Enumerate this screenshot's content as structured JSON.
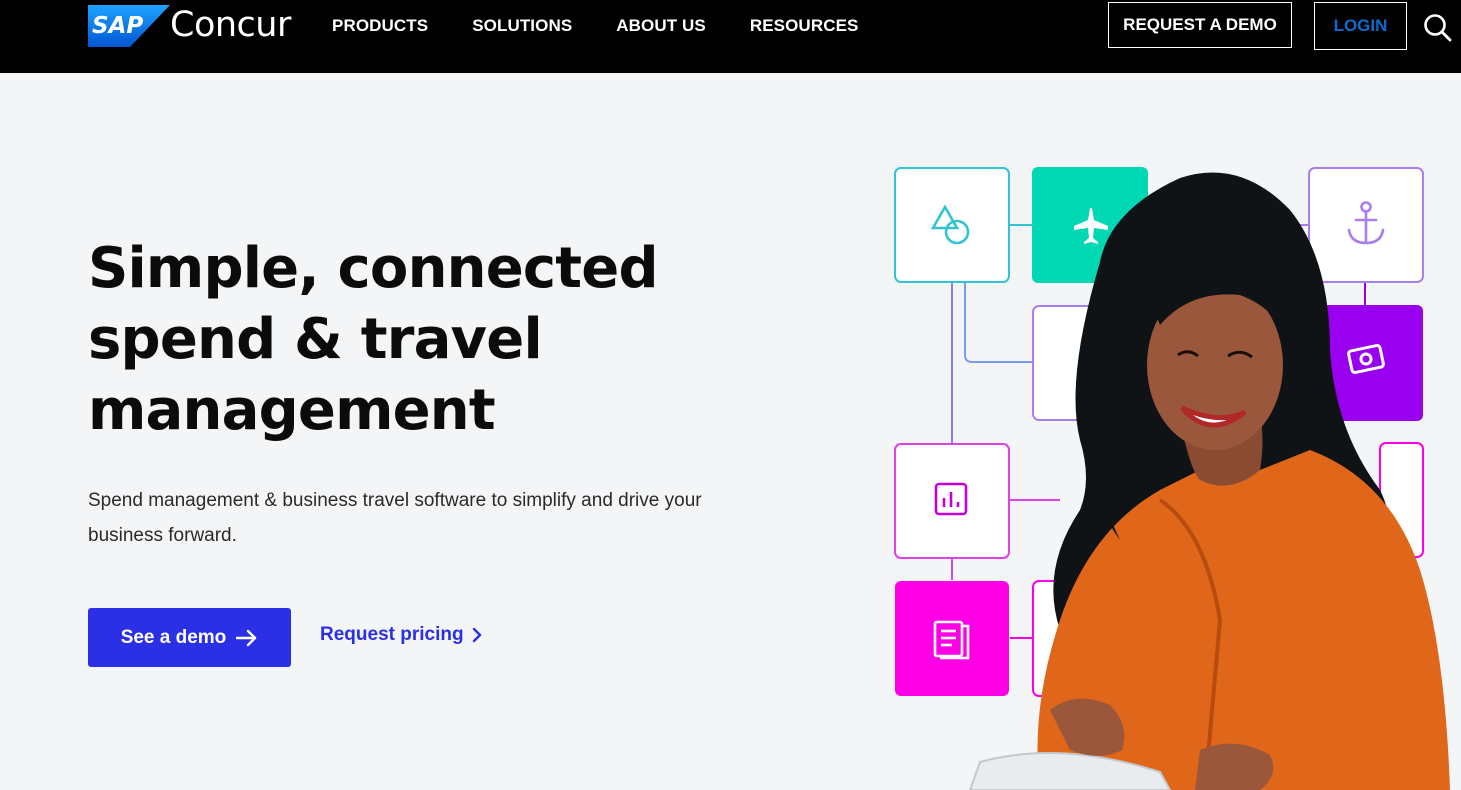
{
  "header": {
    "logo_text": "SAP",
    "brand": "Concur",
    "nav": [
      "PRODUCTS",
      "SOLUTIONS",
      "ABOUT US",
      "RESOURCES"
    ],
    "request_demo_label": "REQUEST A DEMO",
    "login_label": "LOGIN",
    "search_icon": "search-icon"
  },
  "hero": {
    "title": "Simple, connected spend & travel management",
    "subtitle": "Spend management & business travel software to simplify and drive your business forward.",
    "primary_cta": "See a demo",
    "secondary_cta": "Request pricing"
  },
  "illustration": {
    "tiles": [
      "shapes-icon",
      "airplane-icon",
      "anchor-icon",
      "money-icon",
      "chart-icon",
      "document-icon"
    ],
    "colors": {
      "teal": "#00d8b4",
      "purple": "#9a00f0",
      "magenta": "#ff00e6",
      "lavender": "#a97ff0",
      "cyan": "#33c4d4",
      "orange": "#e0661a"
    }
  },
  "colors": {
    "primary": "#2b2fe6",
    "login_text": "#0a6ed1",
    "header_bg": "#000000",
    "page_bg": "#f4f5f7"
  }
}
